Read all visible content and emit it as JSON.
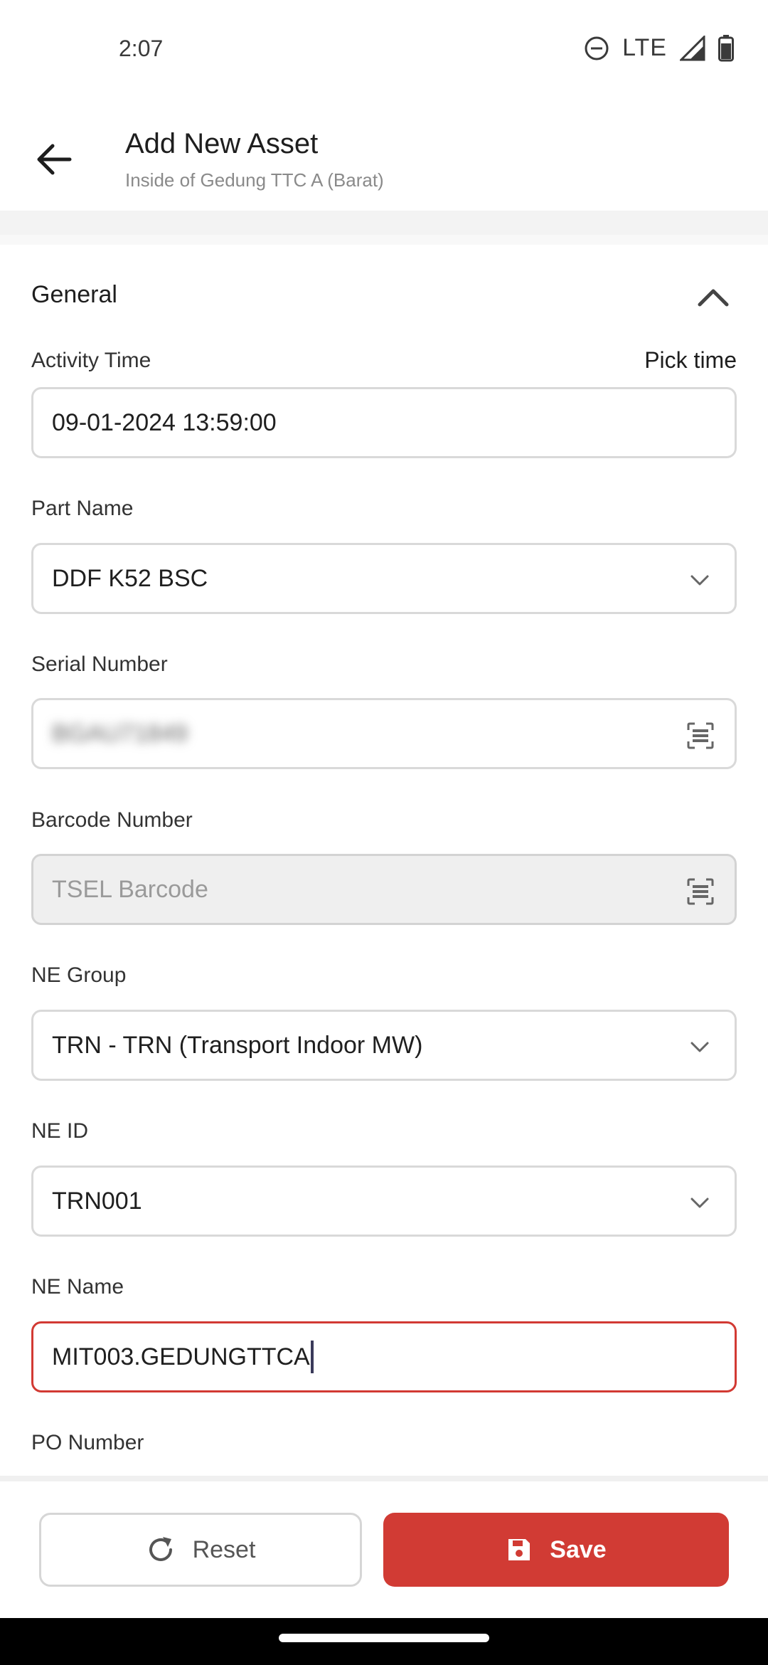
{
  "status_bar": {
    "time": "2:07",
    "network": "LTE",
    "icons": [
      "do-not-disturb-icon",
      "signal-icon",
      "battery-icon"
    ]
  },
  "header": {
    "title": "Add New Asset",
    "subtitle": "Inside of Gedung TTC A (Barat)"
  },
  "section": {
    "title": "General",
    "expanded": true
  },
  "fields": {
    "activity_time": {
      "label": "Activity Time",
      "action": "Pick time",
      "value": "09-01-2024 13:59:00"
    },
    "part_name": {
      "label": "Part Name",
      "value": "DDF K52 BSC"
    },
    "serial_number": {
      "label": "Serial Number",
      "value": "BGAU71849"
    },
    "barcode_number": {
      "label": "Barcode Number",
      "placeholder": "TSEL Barcode"
    },
    "ne_group": {
      "label": "NE Group",
      "value": "TRN - TRN (Transport Indoor MW)"
    },
    "ne_id": {
      "label": "NE ID",
      "value": "TRN001"
    },
    "ne_name": {
      "label": "NE Name",
      "value": "MIT003.GEDUNGTTCA"
    },
    "po_number": {
      "label": "PO Number"
    }
  },
  "actions": {
    "reset_label": "Reset",
    "save_label": "Save"
  },
  "colors": {
    "accent": "#d13b34",
    "border": "#d9d9d9",
    "disabled_bg": "#efefef"
  }
}
